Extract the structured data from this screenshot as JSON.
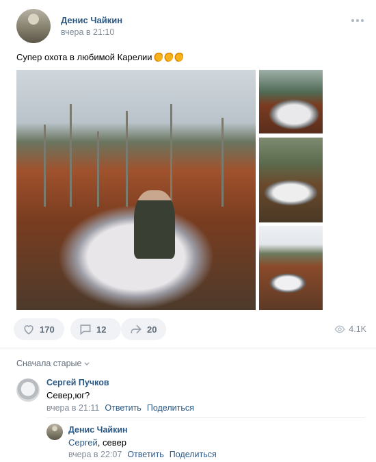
{
  "post": {
    "author": "Денис Чайкин",
    "time": "вчера в 21:10",
    "text": "Супер охота в любимой Карелии",
    "emoji_icon": "flexed-biceps-emoji"
  },
  "actions": {
    "likes": "170",
    "comments": "12",
    "shares": "20",
    "views": "4.1K"
  },
  "comments_section": {
    "sort_label": "Сначала старые",
    "items": [
      {
        "author": "Сергей Пучков",
        "text": "Север,юг?",
        "time": "вчера в 21:11",
        "reply_label": "Ответить",
        "share_label": "Поделиться"
      },
      {
        "author": "Денис Чайкин",
        "reply_to": "Сергей",
        "text": ", север",
        "time": "вчера в 22:07",
        "reply_label": "Ответить",
        "share_label": "Поделиться"
      }
    ]
  },
  "colors": {
    "link": "#2a5885",
    "muted": "#818c99",
    "button_bg": "#f0f2f5"
  }
}
